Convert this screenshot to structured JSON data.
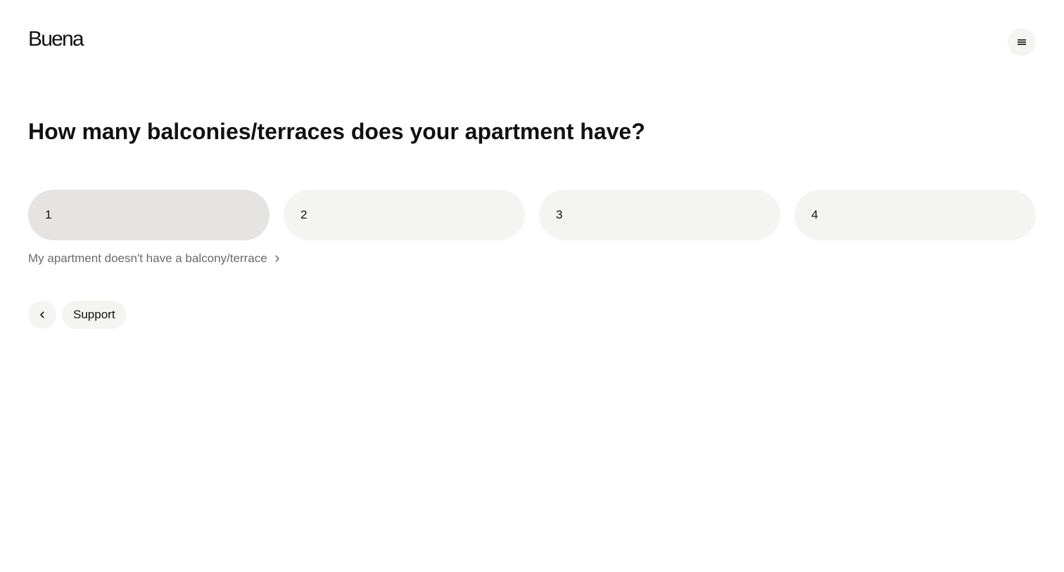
{
  "header": {
    "logo_text": "Buena",
    "menu_icon": "menu-icon"
  },
  "question": {
    "title": "How many balconies/terraces does your apartment have?"
  },
  "options": [
    {
      "label": "1",
      "selected": true
    },
    {
      "label": "2",
      "selected": false
    },
    {
      "label": "3",
      "selected": false
    },
    {
      "label": "4",
      "selected": false
    }
  ],
  "skip_link": {
    "label": "My apartment doesn't have a balcony/terrace",
    "icon": "chevron-right-icon"
  },
  "footer": {
    "back_icon": "chevron-left-icon",
    "support_label": "Support"
  },
  "colors": {
    "option_background": "#f4f4f2",
    "option_selected_background": "#e5e4e2",
    "muted_text": "#6b6b6b"
  }
}
